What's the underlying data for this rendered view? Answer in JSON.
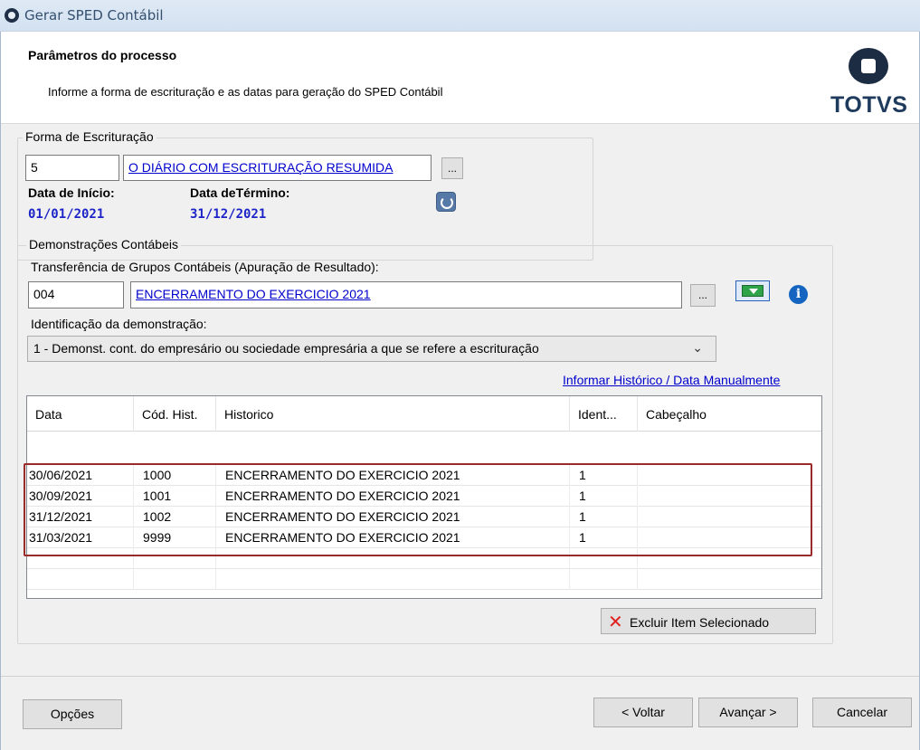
{
  "window": {
    "title": "Gerar SPED Contábil"
  },
  "header": {
    "heading": "Parâmetros do processo",
    "subheading": "Informe a forma de escrituração e as datas para geração do SPED Contábil",
    "logo": "TOTVS"
  },
  "forma": {
    "legend": "Forma de Escrituração",
    "code": "5",
    "description": "O DIÁRIO COM ESCRITURAÇÃO RESUMIDA",
    "lookup_label": "...",
    "start_label": "Data de Início:",
    "start_value": "01/01/2021",
    "end_label": "Data deTérmino:",
    "end_value": "31/12/2021"
  },
  "demonstracoes": {
    "legend": "Demonstrações Contábeis",
    "transfer_label": "Transferência de Grupos Contábeis (Apuração de Resultado):",
    "transfer_code": "004",
    "transfer_description": "ENCERRAMENTO DO EXERCICIO 2021",
    "lookup_label": "...",
    "ident_label": "Identificação da demonstração:",
    "ident_selected": "1 - Demonst. cont. do empresário ou sociedade empresária a que se refere a escrituração",
    "manual_link": "Informar Histórico / Data Manualmente",
    "delete_button": "Excluir Item Selecionado"
  },
  "grid": {
    "columns": [
      "Data",
      "Cód. Hist.",
      "Historico",
      "Ident...",
      "Cabeçalho"
    ],
    "rows": [
      {
        "data": "30/06/2021",
        "cod": "1000",
        "historico": "ENCERRAMENTO DO EXERCICIO 2021",
        "ident": "1",
        "cabecalho": ""
      },
      {
        "data": "30/09/2021",
        "cod": "1001",
        "historico": "ENCERRAMENTO DO EXERCICIO 2021",
        "ident": "1",
        "cabecalho": ""
      },
      {
        "data": "31/12/2021",
        "cod": "1002",
        "historico": "ENCERRAMENTO DO EXERCICIO 2021",
        "ident": "1",
        "cabecalho": ""
      },
      {
        "data": "31/03/2021",
        "cod": "9999",
        "historico": "ENCERRAMENTO DO EXERCICIO 2021",
        "ident": "1",
        "cabecalho": ""
      }
    ]
  },
  "footer": {
    "options": "Opções",
    "back": "< Voltar",
    "next": "Avançar >",
    "cancel": "Cancelar"
  },
  "icons": {
    "app": "app-logo-icon",
    "refresh": "refresh-icon",
    "filter": "green-dropdown-icon",
    "info": "info-icon",
    "delete": "red-x-icon"
  }
}
